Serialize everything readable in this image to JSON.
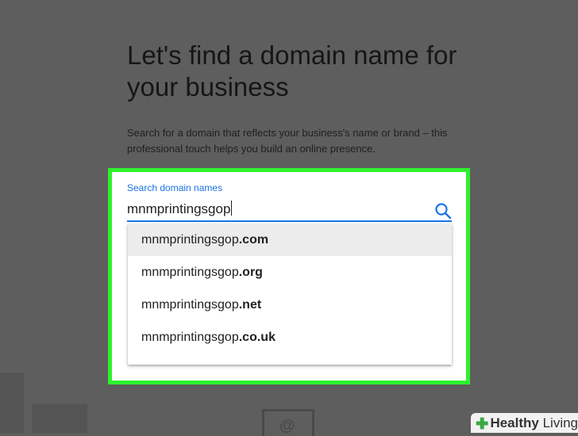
{
  "page": {
    "headline": "Let's find a domain name for your business",
    "subtext": "Search for a domain that reflects your business's name or brand – this professional touch helps you build an online presence."
  },
  "search": {
    "label": "Search domain names",
    "value": "mnmprintingsgop",
    "icon": "search-icon"
  },
  "suggestions": [
    {
      "name": "mnmprintingsgop",
      "tld": ".com",
      "highlighted": true
    },
    {
      "name": "mnmprintingsgop",
      "tld": ".org",
      "highlighted": false
    },
    {
      "name": "mnmprintingsgop",
      "tld": ".net",
      "highlighted": false
    },
    {
      "name": "mnmprintingsgop",
      "tld": ".co.uk",
      "highlighted": false
    }
  ],
  "watermark": {
    "text_bold": "Healthy",
    "text_rest": " Living"
  },
  "colors": {
    "accent": "#1a73e8",
    "highlight_border": "#2ef12e",
    "overlay": "#5e5e5e"
  }
}
